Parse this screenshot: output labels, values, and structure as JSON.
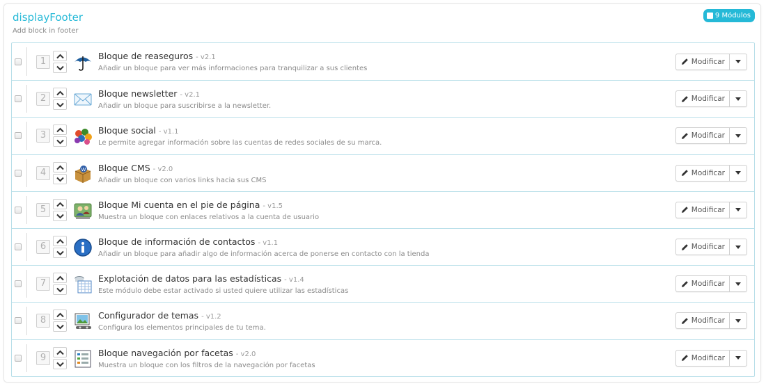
{
  "hook": {
    "title": "displayFooter",
    "description": "Add block in footer",
    "badge_label": "9 Módulos"
  },
  "edit_label": "Modificar",
  "modules": [
    {
      "position": "1",
      "name": "Bloque de reaseguros",
      "version": "- v2.1",
      "description": "Añadir un bloque para ver más informaciones para tranquilizar a sus clientes",
      "icon": "umbrella-icon"
    },
    {
      "position": "2",
      "name": "Bloque newsletter",
      "version": "- v2.1",
      "description": "Añadir un bloque para suscribirse a la newsletter.",
      "icon": "envelope-icon"
    },
    {
      "position": "3",
      "name": "Bloque social",
      "version": "- v1.1",
      "description": "Le permite agregar información sobre las cuentas de redes sociales de su marca.",
      "icon": "social-icons-icon"
    },
    {
      "position": "4",
      "name": "Bloque CMS",
      "version": "- v2.0",
      "description": "Añadir un bloque con varios links hacia sus CMS",
      "icon": "cms-box-icon"
    },
    {
      "position": "5",
      "name": "Bloque Mi cuenta en el pie de página",
      "version": "- v1.5",
      "description": "Muestra un bloque con enlaces relativos a la cuenta de usuario",
      "icon": "user-account-icon"
    },
    {
      "position": "6",
      "name": "Bloque de información de contactos",
      "version": "- v1.1",
      "description": "Añadir un bloque para añadir algo de información acerca de ponerse en contacto con la tienda",
      "icon": "info-icon"
    },
    {
      "position": "7",
      "name": "Explotación de datos para las estadísticas",
      "version": "- v1.4",
      "description": "Este módulo debe estar activado si usted quiere utilizar las estadísticas",
      "icon": "data-table-icon"
    },
    {
      "position": "8",
      "name": "Configurador de temas",
      "version": "- v1.2",
      "description": "Configura los elementos principales de tu tema.",
      "icon": "theme-configurator-icon"
    },
    {
      "position": "9",
      "name": "Bloque navegación por facetas",
      "version": "- v2.0",
      "description": "Muestra un bloque con los filtros de la navegación por facetas",
      "icon": "facet-list-icon"
    }
  ]
}
